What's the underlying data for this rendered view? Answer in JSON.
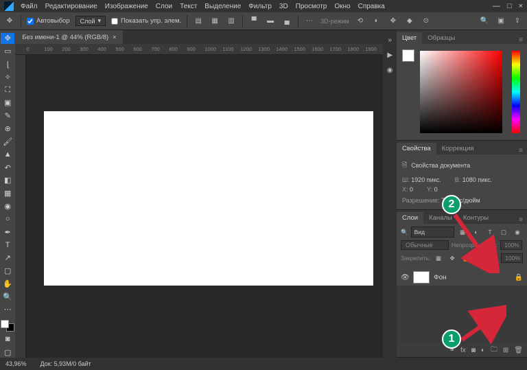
{
  "menu": [
    "Файл",
    "Редактирование",
    "Изображение",
    "Слои",
    "Текст",
    "Выделение",
    "Фильтр",
    "3D",
    "Просмотр",
    "Окно",
    "Справка"
  ],
  "windowControls": {
    "min": "—",
    "max": "□",
    "close": "×"
  },
  "options": {
    "autoSelect": "Автовыбор",
    "layerDropdown": "Слой",
    "showControls": "Показать упр. элем.",
    "mode3d": "3D-режим"
  },
  "tab": {
    "label": "Без имени-1 @ 44% (RGB/8)",
    "close": "×"
  },
  "rulerH": [
    "0",
    "100",
    "200",
    "300",
    "400",
    "500",
    "600",
    "700",
    "800",
    "900",
    "1000",
    "1100",
    "1200",
    "1300",
    "1400",
    "1500",
    "1600",
    "1700",
    "1800",
    "1900"
  ],
  "panelTabs": {
    "color": "Цвет",
    "swatches": "Образцы",
    "props": "Свойства",
    "corr": "Коррекция",
    "layers": "Слои",
    "channels": "Каналы",
    "paths": "Контуры"
  },
  "props": {
    "docProps": "Свойства документа",
    "w": "Ш:",
    "wval": "1920 пикс.",
    "h": "В:",
    "hval": "1080 пикс.",
    "x": "X:",
    "xval": "0",
    "y": "Y:",
    "yval": "0",
    "res": "Разрешение:",
    "resval": "72 пикс/дюйм"
  },
  "layers": {
    "search": "Вид",
    "blend": "Обычные",
    "opacity": "Непрозрачность:",
    "opval": "100%",
    "lock": "Закрепить:",
    "fill": "Заливка:",
    "fillval": "100%",
    "bg": "Фон"
  },
  "status": {
    "zoom": "43,96%",
    "doc": "Док: 5,93M/0 байт"
  },
  "annotations": {
    "n1": "1",
    "n2": "2"
  }
}
